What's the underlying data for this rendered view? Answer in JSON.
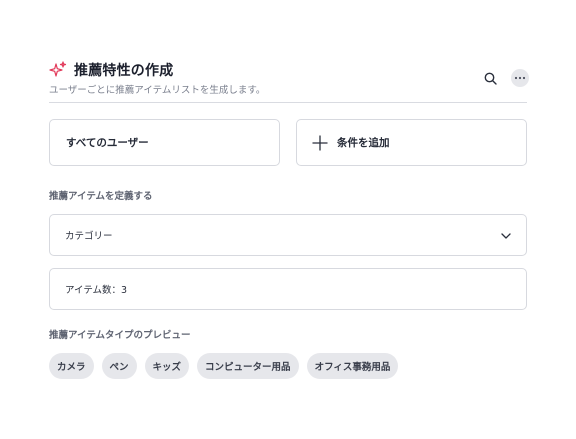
{
  "header": {
    "title": "推薦特性の作成",
    "subtitle": "ユーザーごとに推薦アイテムリストを生成します。",
    "title_icon": "sparkle-icon",
    "accent_color": "#e23a5a"
  },
  "actions": {
    "search_icon": "search-icon",
    "more_icon": "more-horizontal-icon"
  },
  "audience": {
    "users_label": "すべてのユーザー",
    "add_condition_label": "条件を追加"
  },
  "define": {
    "section_label": "推薦アイテムを定義する",
    "category_value": "カテゴリー",
    "item_count_value": "アイテム数：3"
  },
  "preview": {
    "section_label": "推薦アイテムタイプのプレビュー",
    "chips": [
      "カメラ",
      "ペン",
      "キッズ",
      "コンピューター用品",
      "オフィス事務用品"
    ]
  }
}
